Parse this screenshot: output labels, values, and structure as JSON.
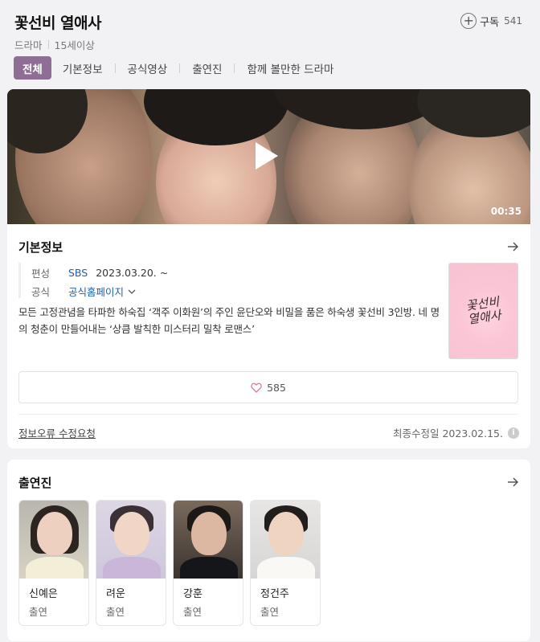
{
  "header": {
    "title": "꽃선비 열애사",
    "genre": "드라마",
    "rating": "15세이상",
    "subscribe_label": "구독",
    "subscribe_count": "541"
  },
  "tabs": [
    {
      "label": "전체",
      "active": true
    },
    {
      "label": "기본정보",
      "active": false
    },
    {
      "label": "공식영상",
      "active": false
    },
    {
      "label": "출연진",
      "active": false
    },
    {
      "label": "함께 볼만한 드라마",
      "active": false
    }
  ],
  "video": {
    "duration": "00:35"
  },
  "basic_info": {
    "section_title": "기본정보",
    "broadcast_label": "편성",
    "broadcaster": "SBS",
    "air_date": "2023.03.20. ~",
    "official_label": "공식",
    "official_link": "공식홈페이지",
    "description": "모든 고정관념을 타파한 하숙집 ‘객주 이화원’의 주인 윤단오와 비밀을 품은 하숙생 꽃선비 3인방. 네 명의 청춘이 만들어내는 ‘상큼 발칙한 미스터리 밀착 로맨스’",
    "poster_text_line1": "꽃선비",
    "poster_text_line2": "열애사",
    "like_count": "585",
    "report_link": "정보오류 수정요청",
    "last_modified": "최종수정일 2023.02.15."
  },
  "cast_section": {
    "section_title": "출연진",
    "members": [
      {
        "name": "신예은",
        "role": "출연"
      },
      {
        "name": "려운",
        "role": "출연"
      },
      {
        "name": "강훈",
        "role": "출연"
      },
      {
        "name": "정건주",
        "role": "출연"
      }
    ]
  },
  "colors": {
    "active_tab": "#8e6e94",
    "link": "#1b5fb6",
    "heart": "#e07a8a"
  }
}
